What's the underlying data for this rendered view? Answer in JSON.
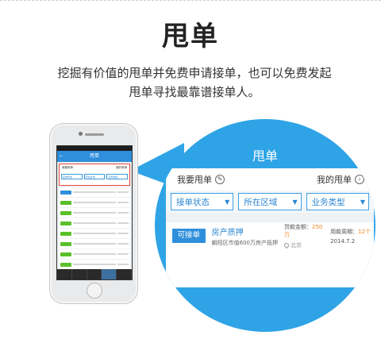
{
  "page": {
    "title": "甩单",
    "subtitle": "挖掘有价值的甩单并免费申请接单，也可以免费发起甩单寻找最靠谱接单人。"
  },
  "phone_screen": {
    "header_title": "甩单",
    "back_icon": "back-arrow-icon",
    "tabbar_active_index": 3,
    "row_tag_colors": [
      "#2f8fdc",
      "#5bbf2a",
      "#5bbf2a",
      "#5bbf2a",
      "#5bbf2a",
      "#5bbf2a",
      "#5bbf2a",
      "#5bbf2a",
      "#5bbf2a",
      "#9b59b6"
    ]
  },
  "zoom": {
    "header_title": "甩单",
    "my_post_label": "我要甩单",
    "my_post_icon": "edit-icon",
    "my_orders_label": "我的甩单",
    "my_orders_icon": "chevron-right-icon",
    "filters": [
      {
        "label": "接单状态",
        "icon": "caret-down-icon"
      },
      {
        "label": "所在区域",
        "icon": "caret-down-icon"
      },
      {
        "label": "业务类型",
        "icon": "caret-down-icon"
      }
    ],
    "listing": {
      "action_label": "可接单",
      "category": "房产质押",
      "description": "朝阳区市值600万房产抵押",
      "loan_amount_label": "贷款金额：",
      "loan_amount_value": "250万",
      "location": "北京",
      "cycle_label": "用款周期：",
      "cycle_value": "12个",
      "date": "2014.7.2"
    }
  },
  "colors": {
    "accent": "#2ea4e6",
    "button": "#2f8fdc",
    "highlight_border": "#e84a3c",
    "amount": "#f08a24"
  }
}
